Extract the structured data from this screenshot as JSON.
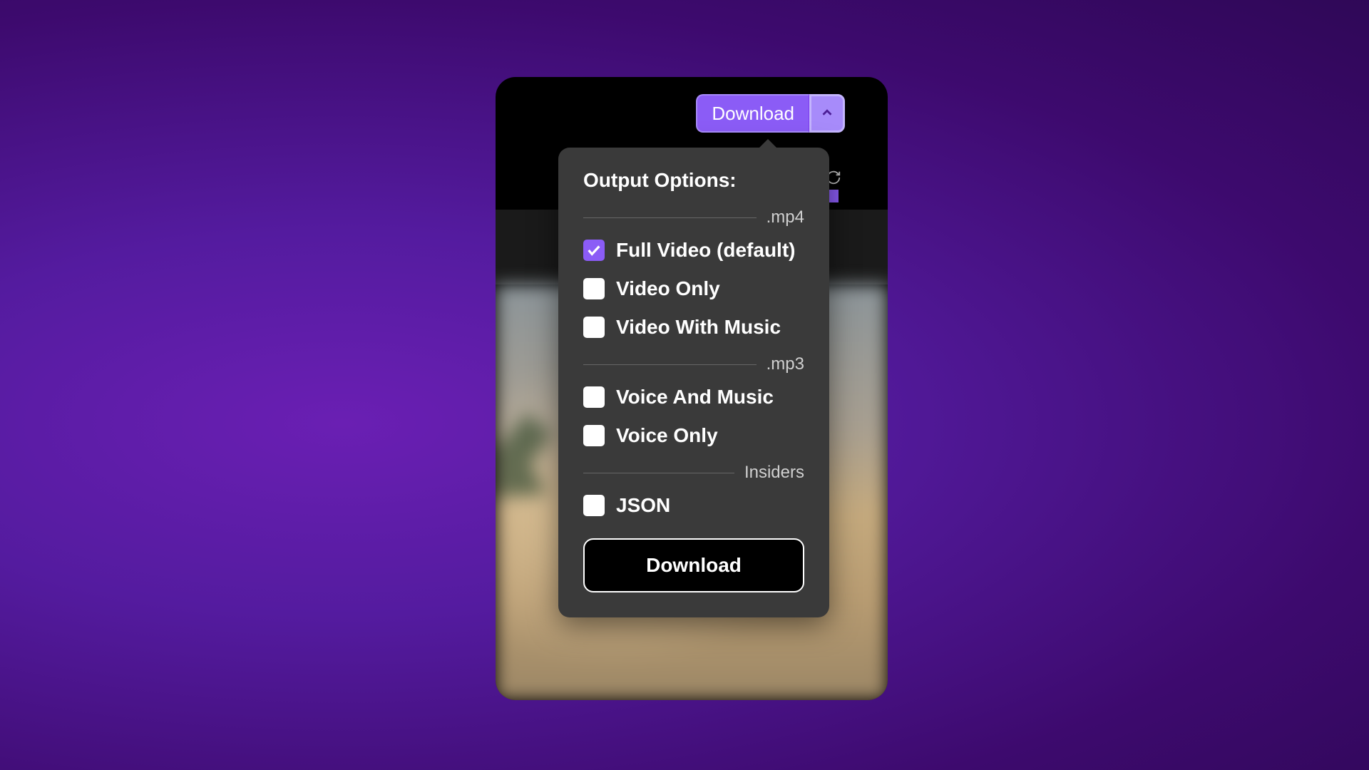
{
  "topbar": {
    "download_label": "Download"
  },
  "panel": {
    "title": "Output Options:",
    "sections": {
      "mp4_label": ".mp4",
      "mp3_label": ".mp3",
      "insiders_label": "Insiders"
    },
    "options": {
      "full_video": {
        "label": "Full Video (default)",
        "checked": true
      },
      "video_only": {
        "label": "Video Only",
        "checked": false
      },
      "video_with_music": {
        "label": "Video With Music",
        "checked": false
      },
      "voice_and_music": {
        "label": "Voice And Music",
        "checked": false
      },
      "voice_only": {
        "label": "Voice Only",
        "checked": false
      },
      "json": {
        "label": "JSON",
        "checked": false
      }
    },
    "download_button_label": "Download"
  }
}
